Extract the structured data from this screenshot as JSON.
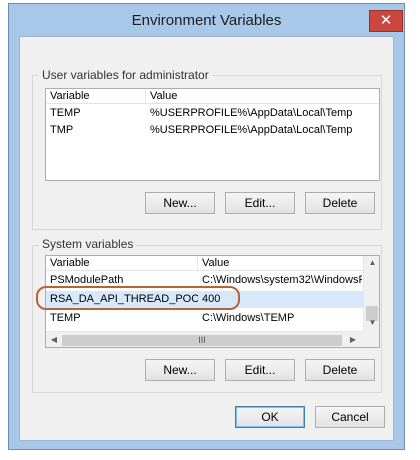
{
  "window": {
    "title": "Environment Variables",
    "close_glyph": "✕"
  },
  "user_vars": {
    "group_label": "User variables for administrator",
    "columns": [
      "Variable",
      "Value"
    ],
    "rows": [
      {
        "variable": "TEMP",
        "value": "%USERPROFILE%\\AppData\\Local\\Temp"
      },
      {
        "variable": "TMP",
        "value": "%USERPROFILE%\\AppData\\Local\\Temp"
      }
    ],
    "buttons": {
      "new": "New...",
      "edit": "Edit...",
      "delete": "Delete"
    }
  },
  "system_vars": {
    "group_label": "System variables",
    "columns": [
      "Variable",
      "Value"
    ],
    "rows": [
      {
        "variable": "PSModulePath",
        "value": "C:\\Windows\\system32\\WindowsP"
      },
      {
        "variable": "RSA_DA_API_THREAD_POOL",
        "value": "400"
      },
      {
        "variable": "TEMP",
        "value": "C:\\Windows\\TEMP"
      }
    ],
    "buttons": {
      "new": "New...",
      "edit": "Edit...",
      "delete": "Delete"
    },
    "hscroll_thumb_glyph": "III"
  },
  "dialog_buttons": {
    "ok": "OK",
    "cancel": "Cancel"
  },
  "colors": {
    "frame": "#a8c8ea",
    "close_button": "#c9473c",
    "highlight_outline": "#b4643a",
    "dialog_background": "#f0f0f0"
  }
}
